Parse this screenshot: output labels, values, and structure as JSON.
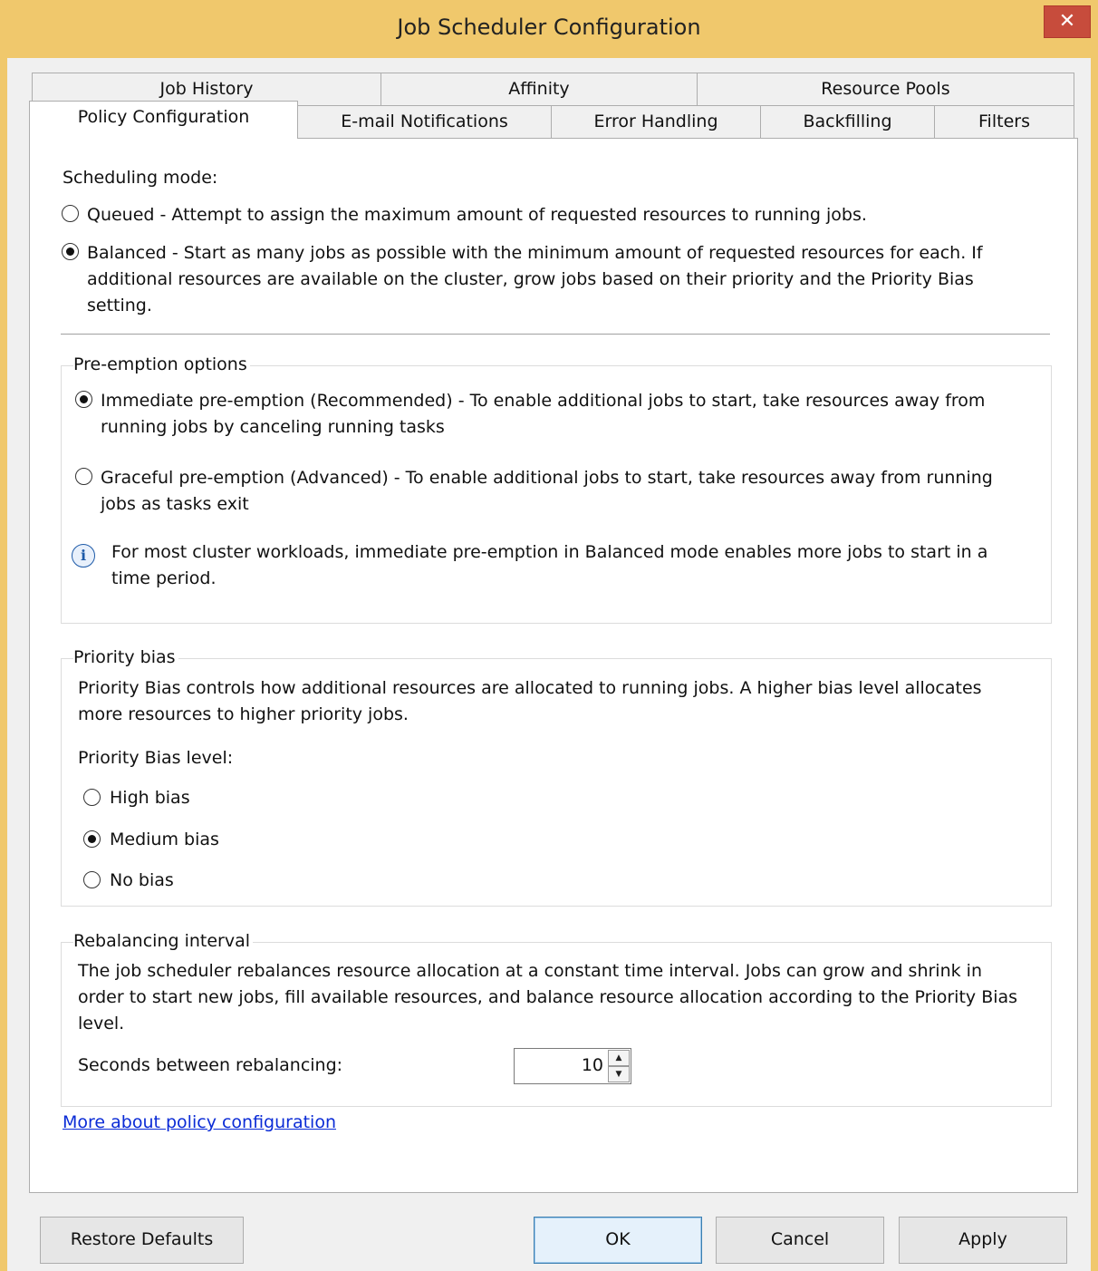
{
  "window": {
    "title": "Job Scheduler Configuration",
    "close_glyph": "✕"
  },
  "tabs": {
    "row1": [
      "Job History",
      "Affinity",
      "Resource Pools"
    ],
    "row2": [
      "Policy Configuration",
      "E-mail Notifications",
      "Error Handling",
      "Backfilling",
      "Filters"
    ],
    "active": "Policy Configuration"
  },
  "scheduling": {
    "label": "Scheduling mode:",
    "queued": {
      "label": "Queued - Attempt to assign the maximum amount of requested resources to running jobs.",
      "checked": false
    },
    "balanced": {
      "line1": "Balanced - Start as many jobs as possible with the minimum amount of requested resources for each. If",
      "line2": "additional resources are available on the cluster, grow jobs based on their priority and the Priority Bias",
      "line3": "setting.",
      "checked": true
    }
  },
  "preemption": {
    "legend": "Pre-emption options",
    "immediate": {
      "line1": "Immediate pre-emption (Recommended) - To enable additional jobs to start, take resources away from",
      "line2": "running jobs by canceling running tasks",
      "checked": true
    },
    "graceful": {
      "line1": "Graceful pre-emption (Advanced) - To enable additional jobs to start, take resources away from running",
      "line2": "jobs as tasks exit",
      "checked": false
    },
    "info_icon": "info-icon",
    "info": {
      "line1": "For most cluster workloads, immediate pre-emption in Balanced mode enables more jobs to start in a",
      "line2": "time period."
    }
  },
  "priority": {
    "legend": "Priority bias",
    "desc1": "Priority Bias  controls how additional resources are allocated to running jobs. A higher bias level allocates",
    "desc2": "more resources to higher priority jobs.",
    "level_label": "Priority Bias level:",
    "options": [
      {
        "label": "High bias",
        "checked": false
      },
      {
        "label": "Medium bias",
        "checked": true
      },
      {
        "label": "No bias",
        "checked": false
      }
    ]
  },
  "rebalancing": {
    "legend": "Rebalancing interval",
    "desc1": "The job scheduler rebalances resource allocation at a constant time interval. Jobs can grow and shrink in",
    "desc2": "order to start new jobs, fill available resources, and balance resource allocation according to the Priority Bias",
    "desc3": "level.",
    "seconds_label": "Seconds between rebalancing:",
    "seconds_value": "10"
  },
  "link": "More about policy configuration",
  "buttons": {
    "restore": "Restore Defaults",
    "ok": "OK",
    "cancel": "Cancel",
    "apply": "Apply"
  }
}
